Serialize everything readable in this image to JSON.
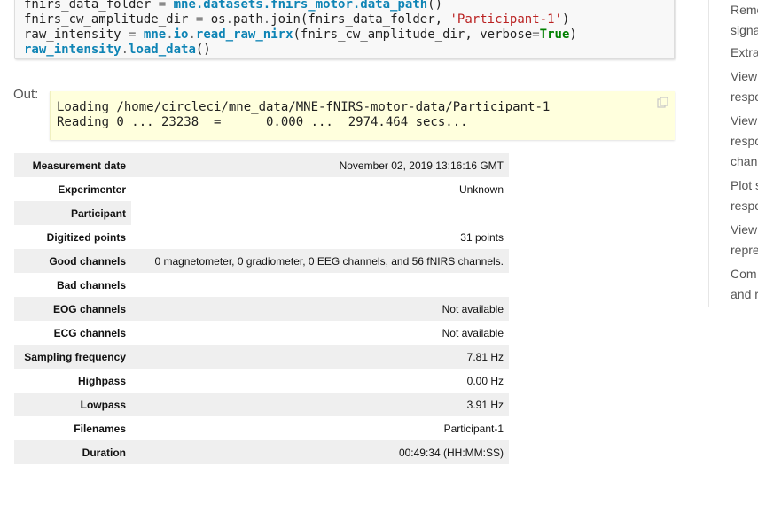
{
  "code": {
    "lines": [
      [
        {
          "t": "fnirs_data_folder ",
          "c": ""
        },
        {
          "t": "=",
          "c": "tok-op"
        },
        {
          "t": " ",
          "c": ""
        },
        {
          "t": "mne.datasets.fnirs_motor.data_path",
          "c": "tok-mod"
        },
        {
          "t": "()",
          "c": ""
        }
      ],
      [
        {
          "t": "fnirs_cw_amplitude_dir ",
          "c": ""
        },
        {
          "t": "=",
          "c": "tok-op"
        },
        {
          "t": " os",
          "c": ""
        },
        {
          "t": ".",
          "c": "tok-op"
        },
        {
          "t": "path",
          "c": ""
        },
        {
          "t": ".",
          "c": "tok-op"
        },
        {
          "t": "join(fnirs_data_folder, ",
          "c": ""
        },
        {
          "t": "'Participant-1'",
          "c": "tok-str"
        },
        {
          "t": ")",
          "c": ""
        }
      ],
      [
        {
          "t": "raw_intensity ",
          "c": ""
        },
        {
          "t": "=",
          "c": "tok-op"
        },
        {
          "t": " ",
          "c": ""
        },
        {
          "t": "mne",
          "c": "tok-mod"
        },
        {
          "t": ".",
          "c": "tok-op"
        },
        {
          "t": "io",
          "c": "tok-mod"
        },
        {
          "t": ".",
          "c": "tok-op"
        },
        {
          "t": "read_raw_nirx",
          "c": "tok-mod"
        },
        {
          "t": "(fnirs_cw_amplitude_dir, verbose",
          "c": ""
        },
        {
          "t": "=",
          "c": "tok-op"
        },
        {
          "t": "True",
          "c": "tok-kw"
        },
        {
          "t": ")",
          "c": ""
        }
      ],
      [
        {
          "t": "raw_intensity",
          "c": "tok-mod"
        },
        {
          "t": ".",
          "c": "tok-op"
        },
        {
          "t": "load_data",
          "c": "tok-mod"
        },
        {
          "t": "()",
          "c": ""
        }
      ]
    ]
  },
  "output": {
    "label": "Out:",
    "lines": [
      "Loading /home/circleci/mne_data/MNE-fNIRS-motor-data/Participant-1",
      "Reading 0 ... 23238  =      0.000 ...  2974.464 secs..."
    ],
    "copy_icon": "copy-icon"
  },
  "info": {
    "rows": [
      {
        "key": "Measurement date",
        "value": "November 02, 2019 13:16:16 GMT"
      },
      {
        "key": "Experimenter",
        "value": "Unknown"
      },
      {
        "key": "Participant",
        "value": ""
      },
      {
        "key": "Digitized points",
        "value": "31 points"
      },
      {
        "key": "Good channels",
        "value": "0 magnetometer, 0 gradiometer, 0 EEG channels, and 56 fNIRS channels."
      },
      {
        "key": "Bad channels",
        "value": ""
      },
      {
        "key": "EOG channels",
        "value": "Not available"
      },
      {
        "key": "ECG channels",
        "value": "Not available"
      },
      {
        "key": "Sampling frequency",
        "value": "7.81 Hz"
      },
      {
        "key": "Highpass",
        "value": "0.00 Hz"
      },
      {
        "key": "Lowpass",
        "value": "3.91 Hz"
      },
      {
        "key": "Filenames",
        "value": "Participant-1"
      },
      {
        "key": "Duration",
        "value": "00:49:34 (HH:MM:SS)"
      }
    ]
  },
  "sidebar": {
    "items": [
      {
        "label": "Remo\nsigna"
      },
      {
        "label": "Extra"
      },
      {
        "label": "View\nrespo"
      },
      {
        "label": "View\nrespo\nchan"
      },
      {
        "label": "Plot s\nrespo"
      },
      {
        "label": "View\nrepre"
      },
      {
        "label": "Com\nand r"
      }
    ]
  }
}
